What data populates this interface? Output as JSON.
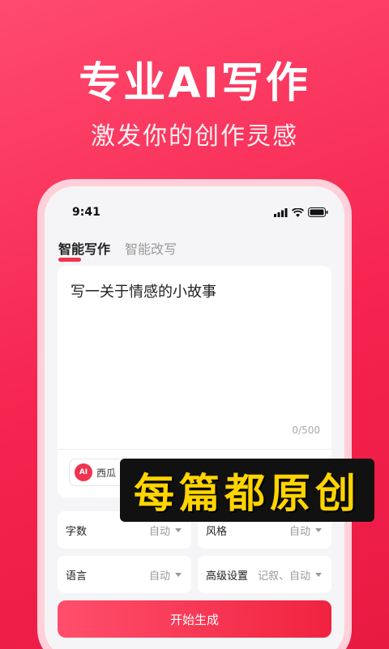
{
  "hero": {
    "title": "专业AI写作",
    "subtitle": "激发你的创作灵感"
  },
  "status_bar": {
    "time": "9:41",
    "icons": [
      "cellular-signal-icon",
      "wifi-icon",
      "battery-icon"
    ]
  },
  "tabs": [
    {
      "label": "智能写作",
      "active": true
    },
    {
      "label": "智能改写",
      "active": false
    }
  ],
  "prompt": {
    "text": "写一关于情感的小故事",
    "counter": "0/500"
  },
  "model": {
    "logo_text": "AI",
    "label": "西瓜"
  },
  "settings": {
    "word_count": {
      "label": "字数",
      "value": "自动"
    },
    "tone": {
      "label": "风格",
      "value": "自动"
    },
    "language": {
      "label": "语言",
      "value": "自动"
    },
    "advanced": {
      "label": "高级设置",
      "value": "记叙、自动"
    }
  },
  "start_button": "开始生成",
  "sticker": "每篇都原创",
  "colors": {
    "brand": "#f0334f",
    "sticker_text": "#ffd400"
  }
}
